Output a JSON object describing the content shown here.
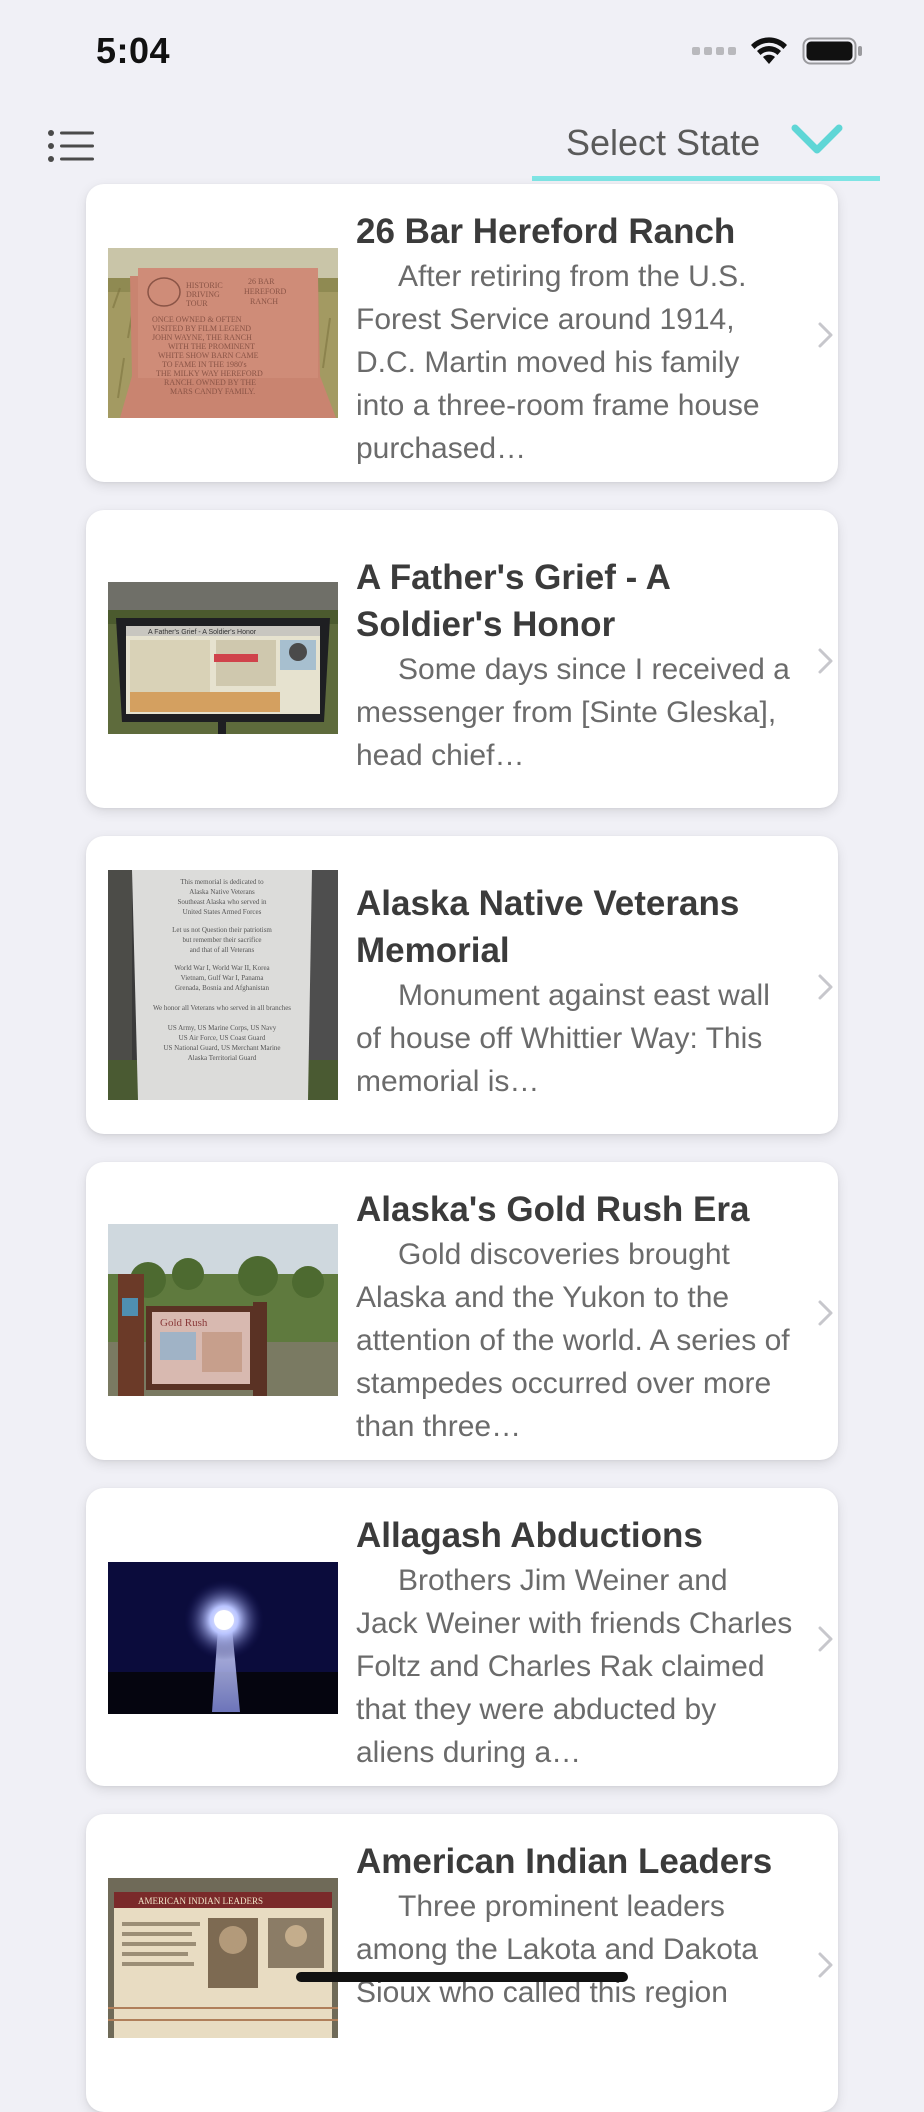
{
  "status_bar": {
    "time": "5:04"
  },
  "header": {
    "menu_icon": "list-icon",
    "state_select_label": "Select State",
    "accent_color": "#5fd6d6"
  },
  "markers": [
    {
      "title": "26 Bar Hereford Ranch",
      "description": "After retiring from the U.S. Forest Service around 1914, D.C. Martin moved his family into a three-room frame house purchased…",
      "sign_text": [
        "HISTORIC",
        "DRIVING",
        "TOUR",
        "26 BAR",
        "HEREFORD",
        "RANCH",
        "ONCE OWNED & OFTEN",
        "VISITED BY FILM LEGEND",
        "JOHN WAYNE, THE RANCH",
        "WITH THE PROMINENT",
        "WHITE SHOW BARN CAME",
        "TO FAME IN THE 1980's",
        "THE MILKY WAY HEREFORD",
        "RANCH. OWNED BY THE",
        "MARS CANDY FAMILY."
      ]
    },
    {
      "title": "A Father's Grief - A Soldier's Honor",
      "description": "Some days since I received a messenger from [Sinte Gleska], head chief…",
      "sign_text": [
        "A Father's Grief - A Soldier's Honor"
      ]
    },
    {
      "title": "Alaska Native Veterans Memorial",
      "description": "Monument against east wall of house off Whittier Way: This memorial is…",
      "sign_text": [
        "This memorial is dedicated to",
        "Alaska Native Veterans",
        "Southeast Alaska who served in",
        "United States Armed Forces",
        "Let us not Question their patriotism",
        "but remember their sacrifice",
        "and that of all Veterans",
        "World War I, World War II, Korea",
        "Vietnam, Gulf War I, Panama",
        "Grenada, Bosnia and Afghanistan",
        "We honor all Veterans who served in all branches",
        "US Army, US Marine Corps, US Navy",
        "US Air Force, US Coast Guard",
        "US National Guard, US Merchant Marine",
        "Alaska Territorial Guard"
      ]
    },
    {
      "title": "Alaska's Gold Rush Era",
      "description": "Gold discoveries brought Alaska and the Yukon to the attention of the world. A series of stampedes occurred over more than three…",
      "sign_text": [
        "Gold Rush"
      ]
    },
    {
      "title": "Allagash Abductions",
      "description": "Brothers Jim Weiner and Jack Weiner with friends Charles Foltz and Charles Rak claimed that they were abducted by aliens during a…",
      "sign_text": []
    },
    {
      "title": "American Indian Leaders",
      "description": "Three prominent leaders among the Lakota and Dakota Sioux who called this region",
      "sign_text": [
        "AMERICAN INDIAN LEADERS"
      ]
    }
  ]
}
